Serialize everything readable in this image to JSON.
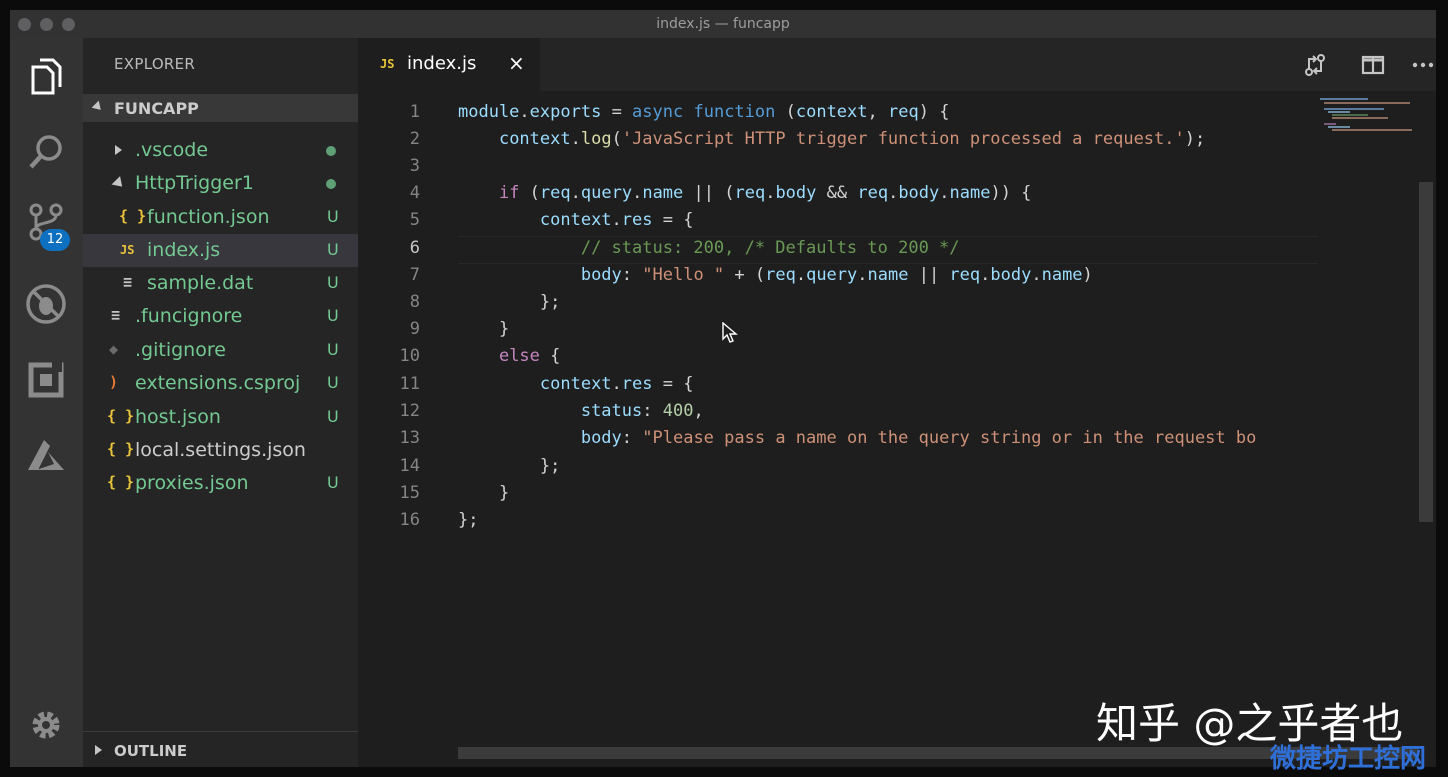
{
  "window": {
    "title": "index.js — funcapp"
  },
  "activity_bar": {
    "icons": [
      "files-icon",
      "search-icon",
      "source-control-icon",
      "debug-icon",
      "extensions-icon",
      "azure-icon",
      "gear-icon"
    ],
    "source_control_badge": "12"
  },
  "sidebar": {
    "title": "EXPLORER",
    "folder": "FUNCAPP",
    "items": [
      {
        "name": ".vscode",
        "icon": "folder-caret",
        "status": "dot"
      },
      {
        "name": "HttpTrigger1",
        "icon": "folder-caret-open",
        "status": "dot"
      },
      {
        "name": "function.json",
        "icon": "{ }",
        "status": "U"
      },
      {
        "name": "index.js",
        "icon": "JS",
        "status": "U"
      },
      {
        "name": "sample.dat",
        "icon": "lines-icon",
        "status": "U"
      },
      {
        "name": ".funcignore",
        "icon": "lines-icon",
        "status": "U"
      },
      {
        "name": ".gitignore",
        "icon": "git-icon",
        "status": "U"
      },
      {
        "name": "extensions.csproj",
        "icon": "rss-icon",
        "status": "U"
      },
      {
        "name": "host.json",
        "icon": "{ }",
        "status": "U"
      },
      {
        "name": "local.settings.json",
        "icon": "{ }",
        "status": ""
      },
      {
        "name": "proxies.json",
        "icon": "{ }",
        "status": "U"
      }
    ],
    "outline": "OUTLINE"
  },
  "editor": {
    "tab": {
      "icon": "JS",
      "label": "index.js",
      "close": "×"
    },
    "toolbar_icons": [
      "compare-changes-icon",
      "split-editor-icon",
      "more-actions-icon"
    ],
    "active_line": 6,
    "line_numbers": [
      "1",
      "2",
      "3",
      "4",
      "5",
      "6",
      "7",
      "8",
      "9",
      "10",
      "11",
      "12",
      "13",
      "14",
      "15",
      "16"
    ]
  },
  "watermark": {
    "text": "知乎 @之乎者也",
    "site": "微捷坊工控网"
  },
  "colors": {
    "accent": "#0e70c0",
    "untracked": "#73c991",
    "json": "#e8c33b"
  }
}
